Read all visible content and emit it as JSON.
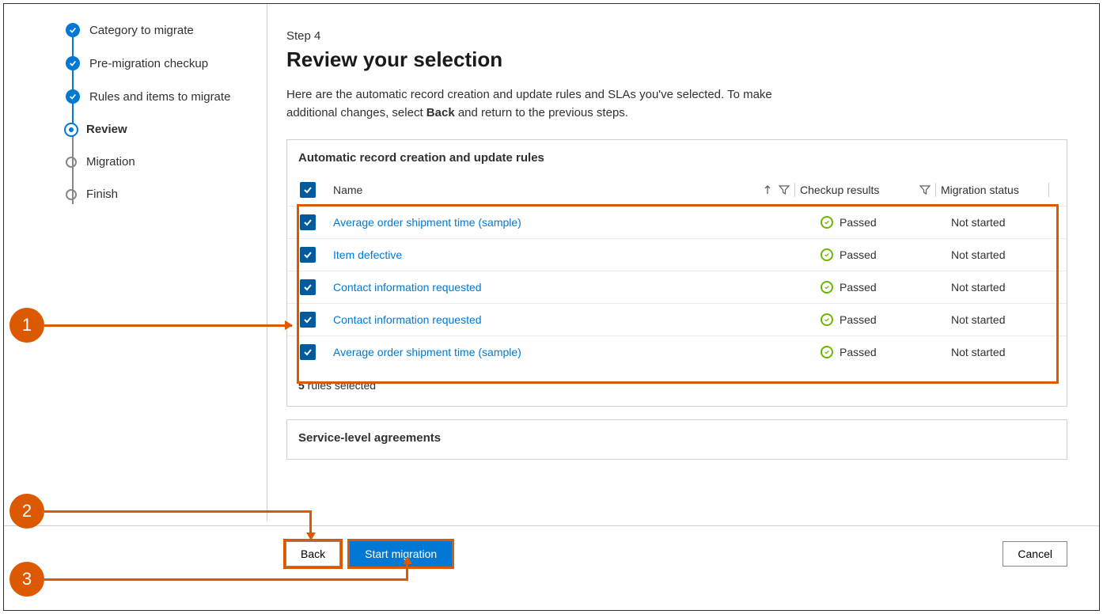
{
  "steps": {
    "items": [
      {
        "label": "Category to migrate",
        "state": "done"
      },
      {
        "label": "Pre-migration checkup",
        "state": "done"
      },
      {
        "label": "Rules and items to migrate",
        "state": "done"
      },
      {
        "label": "Review",
        "state": "current"
      },
      {
        "label": "Migration",
        "state": "pending"
      },
      {
        "label": "Finish",
        "state": "pending"
      }
    ]
  },
  "header": {
    "step_number": "Step 4",
    "title": "Review your selection",
    "description_before": "Here are the automatic record creation and update rules and SLAs you've selected. To make additional changes, select ",
    "description_bold": "Back",
    "description_after": " and return to the previous steps."
  },
  "rules_panel": {
    "title": "Automatic record creation and update rules",
    "columns": {
      "name": "Name",
      "checkup": "Checkup results",
      "status": "Migration status"
    },
    "rows": [
      {
        "name": "Average order shipment time (sample)",
        "checkup": "Passed",
        "status": "Not started"
      },
      {
        "name": "Item defective",
        "checkup": "Passed",
        "status": "Not started"
      },
      {
        "name": "Contact information requested",
        "checkup": "Passed",
        "status": "Not started"
      },
      {
        "name": "Contact information requested",
        "checkup": "Passed",
        "status": "Not started"
      },
      {
        "name": "Average order shipment time (sample)",
        "checkup": "Passed",
        "status": "Not started"
      }
    ],
    "selected_count": "5",
    "selected_suffix": " rules selected"
  },
  "sla_panel": {
    "title": "Service-level agreements"
  },
  "footer": {
    "back": "Back",
    "start": "Start migration",
    "cancel": "Cancel"
  },
  "callouts": {
    "c1": "1",
    "c2": "2",
    "c3": "3"
  }
}
